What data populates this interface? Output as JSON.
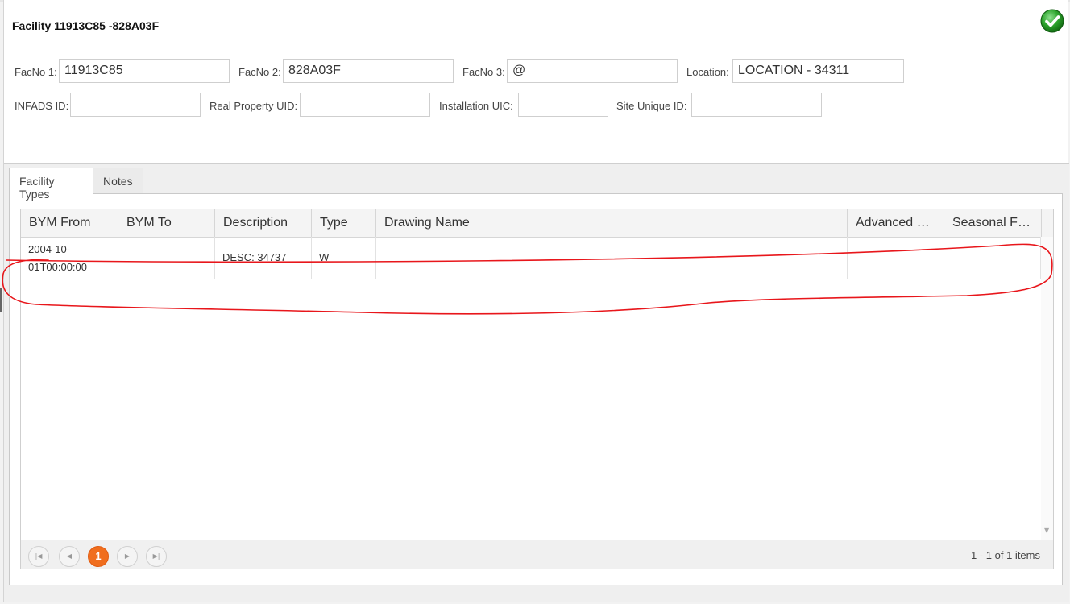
{
  "title": "Facility 11913C85 -828A03F",
  "fields_row1": [
    {
      "label": "FacNo 1:",
      "value": "11913C85"
    },
    {
      "label": "FacNo 2:",
      "value": "828A03F"
    },
    {
      "label": "FacNo 3:",
      "value": "@"
    },
    {
      "label": "Location:",
      "value": "LOCATION - 34311"
    }
  ],
  "fields_row2": [
    {
      "label": "INFADS ID:",
      "value": ""
    },
    {
      "label": "Real Property UID:",
      "value": ""
    },
    {
      "label": "Installation UIC:",
      "value": ""
    },
    {
      "label": "Site Unique ID:",
      "value": ""
    }
  ],
  "tabs": [
    {
      "label": "Facility Types",
      "active": true
    },
    {
      "label": "Notes",
      "active": false
    }
  ],
  "grid": {
    "columns": [
      "BYM From",
      "BYM To",
      "Description",
      "Type",
      "Drawing Name",
      "Advanced S...",
      "Seasonal Fa..."
    ],
    "rows": [
      {
        "bym_from": "2004-10-01T00:00:00",
        "bym_to": "",
        "description": "DESC: 34737",
        "type": "W",
        "drawing_name": "",
        "advanced": "",
        "seasonal": ""
      }
    ]
  },
  "pager": {
    "current_page": "1",
    "info": "1 - 1 of 1 items"
  },
  "icons": {
    "status": "checkmark-circle-icon",
    "first": "first-page-icon",
    "prev": "prev-page-icon",
    "next": "next-page-icon",
    "last": "last-page-icon"
  },
  "colors": {
    "accent": "#f06e1e",
    "ok_green": "#2ea52e",
    "annotation": "#e8161b"
  }
}
